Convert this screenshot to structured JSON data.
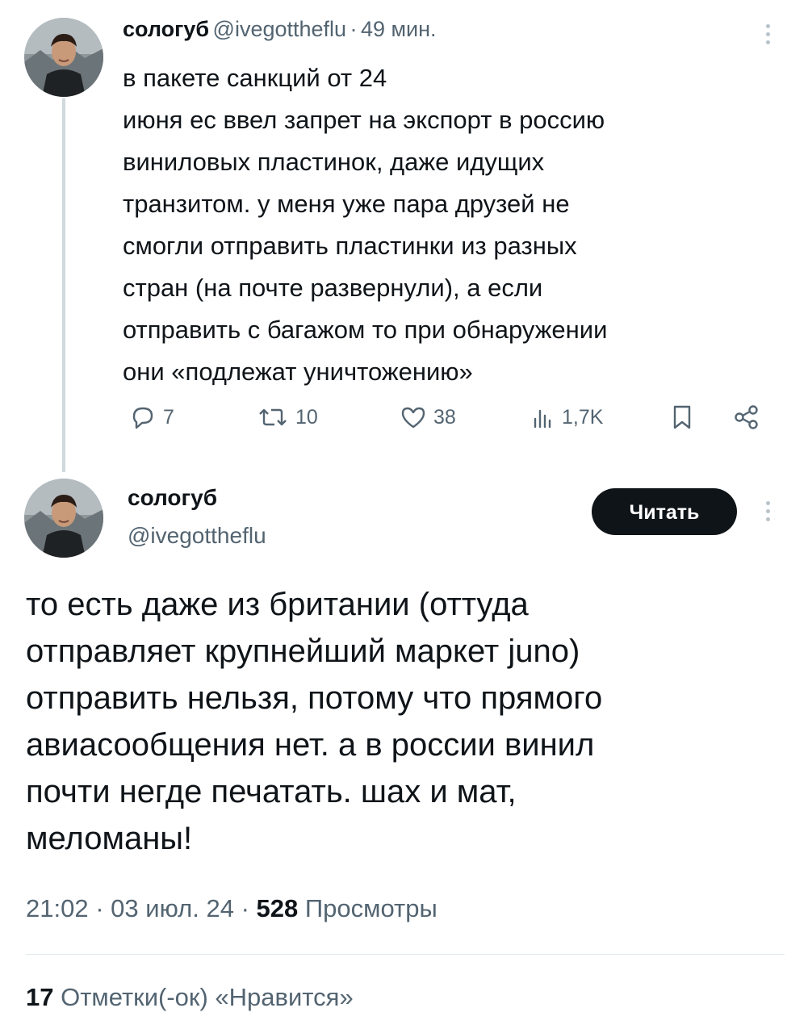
{
  "tweet1": {
    "name": "сологуб",
    "handle": "@ivegottheflu",
    "separator": "·",
    "time": "49 мин.",
    "lines": [
      "в пакете санкций от 24",
      "июня ес ввел запрет на экспорт в россию",
      "виниловых пластинок, даже идущих",
      "транзитом. у меня уже пара друзей не",
      "смогли отправить пластинки из разных",
      "стран (на почте развернули), а если",
      "отправить с багажом то при обнаружении",
      "они «подлежат уничтожению»"
    ],
    "actions": {
      "replies": "7",
      "retweets": "10",
      "likes": "38",
      "views": "1,7K"
    },
    "icons": [
      "reply-icon",
      "retweet-icon",
      "heart-icon",
      "views-icon",
      "bookmark-icon",
      "share-icon",
      "more-icon"
    ]
  },
  "tweet2": {
    "name": "сологуб",
    "handle": "@ivegottheflu",
    "follow_label": "Читать",
    "lines": [
      "то есть даже из британии (оттуда",
      "отправляет крупнейший маркет juno)",
      "отправить нельзя, потому что прямого",
      "авиасообщения нет. а в россии винил",
      "почти негде печатать. шах и мат,",
      "меломаны!"
    ],
    "time": "21:02",
    "separator": "·",
    "date": "03 июл. 24",
    "views_count": "528",
    "views_label": "Просмотры",
    "likes_count": "17",
    "likes_label": "Отметки(-ок) «Нравится»"
  },
  "colors": {
    "text": "#0f1419",
    "secondary": "#536471",
    "thread_line": "#cfd9de",
    "button_bg": "#0f1419",
    "button_text": "#ffffff"
  }
}
